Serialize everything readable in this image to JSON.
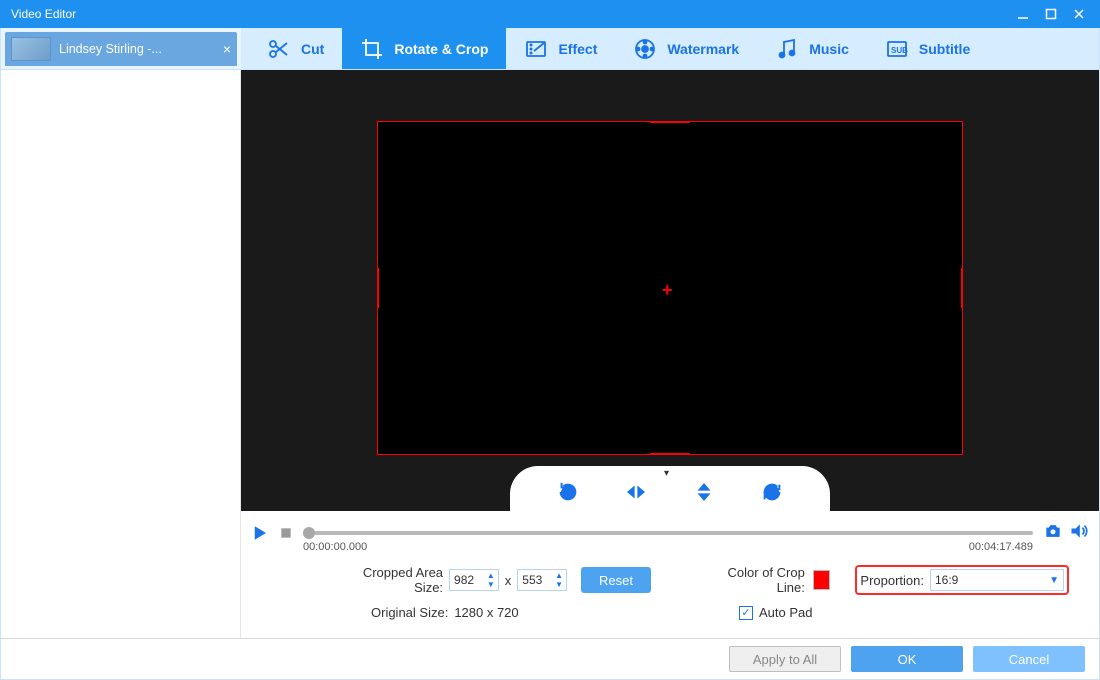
{
  "window": {
    "title": "Video Editor"
  },
  "file_tab": {
    "name": "Lindsey Stirling -..."
  },
  "toolbar": {
    "items": [
      {
        "label": "Cut"
      },
      {
        "label": "Rotate & Crop"
      },
      {
        "label": "Effect"
      },
      {
        "label": "Watermark"
      },
      {
        "label": "Music"
      },
      {
        "label": "Subtitle"
      }
    ],
    "active_index": 1
  },
  "playback": {
    "current_time": "00:00:00.000",
    "total_time": "00:04:17.489"
  },
  "settings": {
    "cropped_area_label": "Cropped Area Size:",
    "width": "982",
    "height": "553",
    "x_separator": "x",
    "reset_label": "Reset",
    "original_size_label": "Original Size:",
    "original_size_value": "1280 x 720",
    "color_label": "Color of Crop Line:",
    "crop_line_color": "#ff0000",
    "proportion_label": "Proportion:",
    "proportion_value": "16:9",
    "auto_pad_label": "Auto Pad",
    "auto_pad_checked": true
  },
  "footer": {
    "apply_all": "Apply to All",
    "ok": "OK",
    "cancel": "Cancel"
  }
}
